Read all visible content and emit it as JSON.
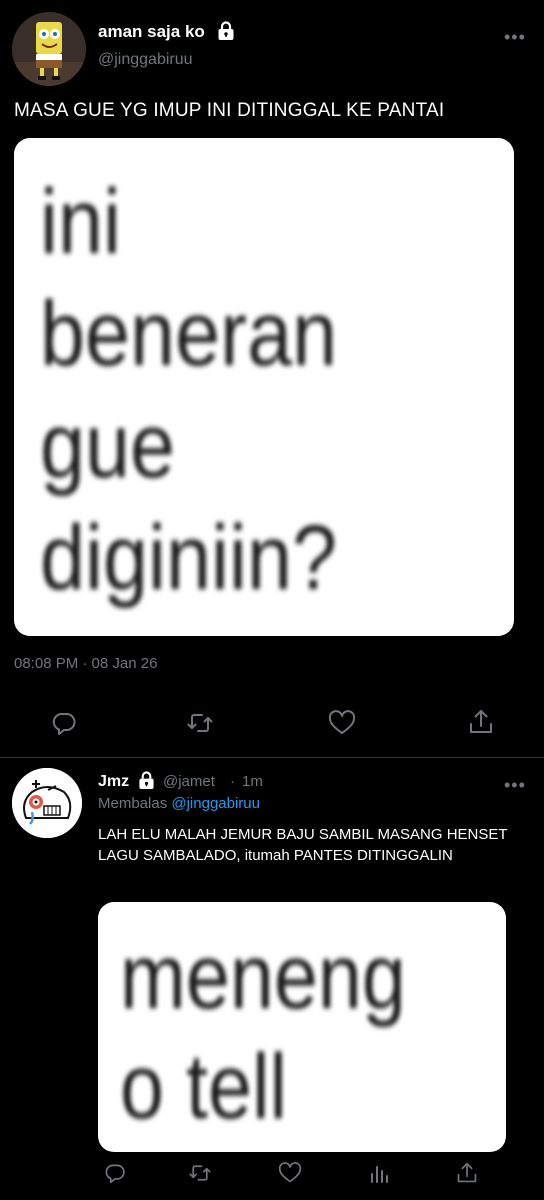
{
  "main_tweet": {
    "author": {
      "display_name": "aman saja ko",
      "handle": "@jinggabiruu",
      "protected_icon": "lock-icon"
    },
    "text": "MASA GUE YG IMUP INI DITINGGAL KE PANTAI",
    "media_lines": [
      "ini",
      "beneran",
      "gue",
      "diginiin?"
    ],
    "timestamp": "08:08 PM · 08 Jan 26",
    "actions": [
      "reply-icon",
      "retweet-icon",
      "like-icon",
      "share-icon"
    ]
  },
  "reply_tweet": {
    "author": {
      "display_name": "Jmz",
      "handle": "@jamet",
      "time": "1m",
      "protected_icon": "lock-icon"
    },
    "replying_label": "Membalas",
    "replying_to": "@jinggabiruu",
    "text": "LAH ELU MALAH JEMUR BAJU SAMBIL MASANG HENSET LAGU SAMBALADO, itumah PANTES DITINGGALIN",
    "media_lines": [
      "meneng",
      "o tell"
    ],
    "actions": [
      "reply-icon",
      "retweet-icon",
      "like-icon",
      "analytics-icon",
      "share-icon"
    ]
  },
  "colors": {
    "background": "#000000",
    "text": "#ffffff",
    "secondary": "#71767b",
    "link": "#1d9bf0",
    "divider": "#2f3336"
  }
}
